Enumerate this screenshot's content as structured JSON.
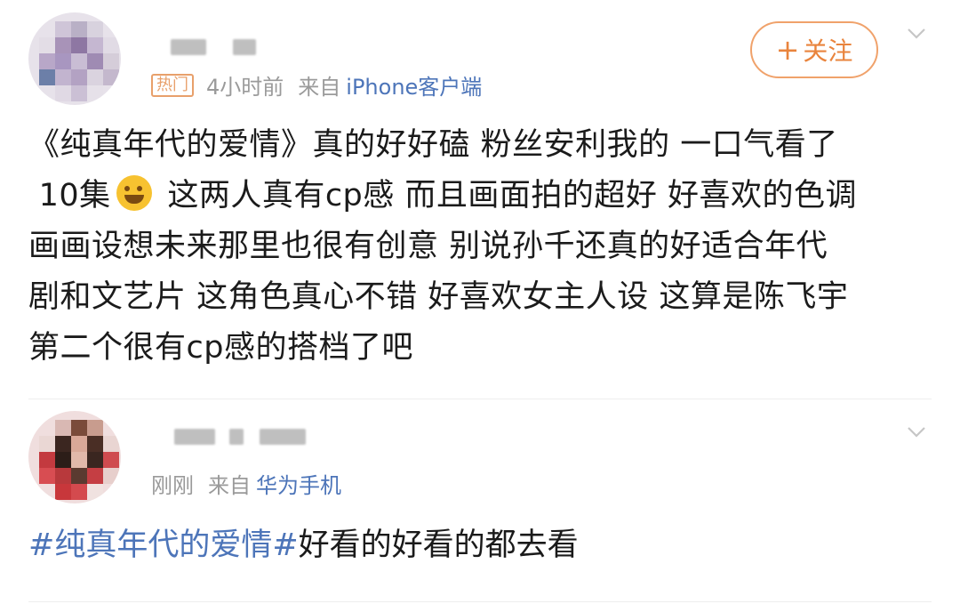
{
  "post1": {
    "badge": "热门",
    "time": "4小时前",
    "from": "来自",
    "source": "iPhone客户端",
    "follow_plus": "+",
    "follow_label": "关注",
    "content_line1": "《纯真年代的爱情》真的好好磕 粉丝安利我的 一口气看了",
    "content_line2_pre": "10集",
    "content_line2_post": " 这两人真有cp感 而且画面拍的超好 好喜欢的色调",
    "content_line3": "画画设想未来那里也很有创意  别说孙千还真的好适合年代",
    "content_line4": "剧和文艺片 这角色真心不错 好喜欢女主人设 这算是陈飞宇",
    "content_line5": "第二个很有cp感的搭档了吧"
  },
  "post2": {
    "time": "刚刚",
    "from": "来自",
    "source": "华为手机",
    "hashtag": "#纯真年代的爱情#",
    "text": "好看的好看的都去看"
  },
  "colors": {
    "accent_orange": "#e9843d",
    "link_blue": "#4d75b9",
    "meta_gray": "#9a9a9a"
  },
  "icons": {
    "emoji": "rolling-on-floor-laughing",
    "chevron": "chevron-down"
  }
}
